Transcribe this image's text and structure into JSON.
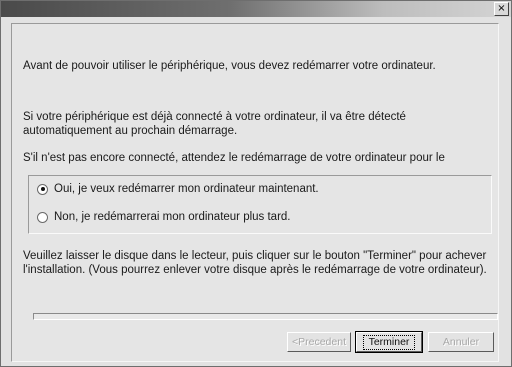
{
  "window": {
    "title": "",
    "close_glyph": "×"
  },
  "body": {
    "intro": "Avant de pouvoir utiliser le périphérique, vous devez redémarrer votre ordinateur.",
    "connected_note": "Si votre périphérique est déjà connecté à votre ordinateur, il va être détecté automatiquement au prochain démarrage.",
    "not_connected_note": "S'il n'est pas encore connecté, attendez le redémarrage de votre ordinateur pour le",
    "instructions": "Veuillez laisser le disque dans le lecteur, puis cliquer sur le bouton \"Terminer\" pour achever l'installation. (Vous pourrez enlever votre disque après le redémarrage de votre ordinateur)."
  },
  "options": [
    {
      "label": "Oui, je veux redémarrer mon ordinateur maintenant.",
      "selected": true
    },
    {
      "label": "Non, je redémarrerai mon ordinateur plus tard.",
      "selected": false
    }
  ],
  "progress": {
    "value": 0
  },
  "buttons": {
    "previous": "<Precedent",
    "finish": "Terminer",
    "cancel": "Annuler"
  }
}
